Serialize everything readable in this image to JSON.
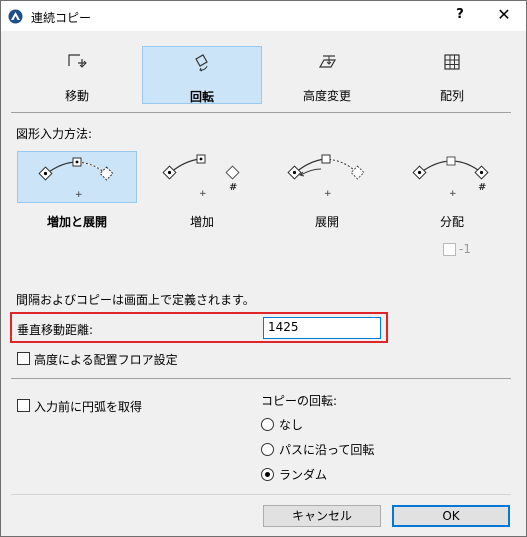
{
  "window": {
    "title": "連続コピー",
    "help_label": "?",
    "close_label": "✕"
  },
  "modes": [
    {
      "label": "移動",
      "icon": "move-icon",
      "selected": false
    },
    {
      "label": "回転",
      "icon": "rotate-icon",
      "selected": true
    },
    {
      "label": "高度変更",
      "icon": "elevate-icon",
      "selected": false
    },
    {
      "label": "配列",
      "icon": "array-icon",
      "selected": false
    }
  ],
  "input_method": {
    "heading": "図形入力方法:",
    "options": [
      {
        "label": "増加と展開",
        "selected": true
      },
      {
        "label": "増加",
        "selected": false
      },
      {
        "label": "展開",
        "selected": false
      },
      {
        "label": "分配",
        "selected": false
      }
    ],
    "count_suffix": "-1",
    "marker_plus": "+",
    "marker_hash": "#"
  },
  "info_text": "間隔およびコピーは画面上で定義されます。",
  "vertical_distance": {
    "label": "垂直移動距離:",
    "value": "1425"
  },
  "floor_by_elevation": {
    "label": "高度による配置フロア設定",
    "checked": false
  },
  "get_arc": {
    "label": "入力前に円弧を取得",
    "checked": false
  },
  "copy_rotation": {
    "heading": "コピーの回転:",
    "options": [
      {
        "label": "なし",
        "selected": false
      },
      {
        "label": "パスに沿って回転",
        "selected": false
      },
      {
        "label": "ランダム",
        "selected": true
      }
    ]
  },
  "buttons": {
    "cancel": "キャンセル",
    "ok": "OK"
  },
  "colors": {
    "selection_bg": "#cce4f7",
    "selection_border": "#99c9ef",
    "highlight": "#e0252a",
    "focus": "#0078d7"
  }
}
